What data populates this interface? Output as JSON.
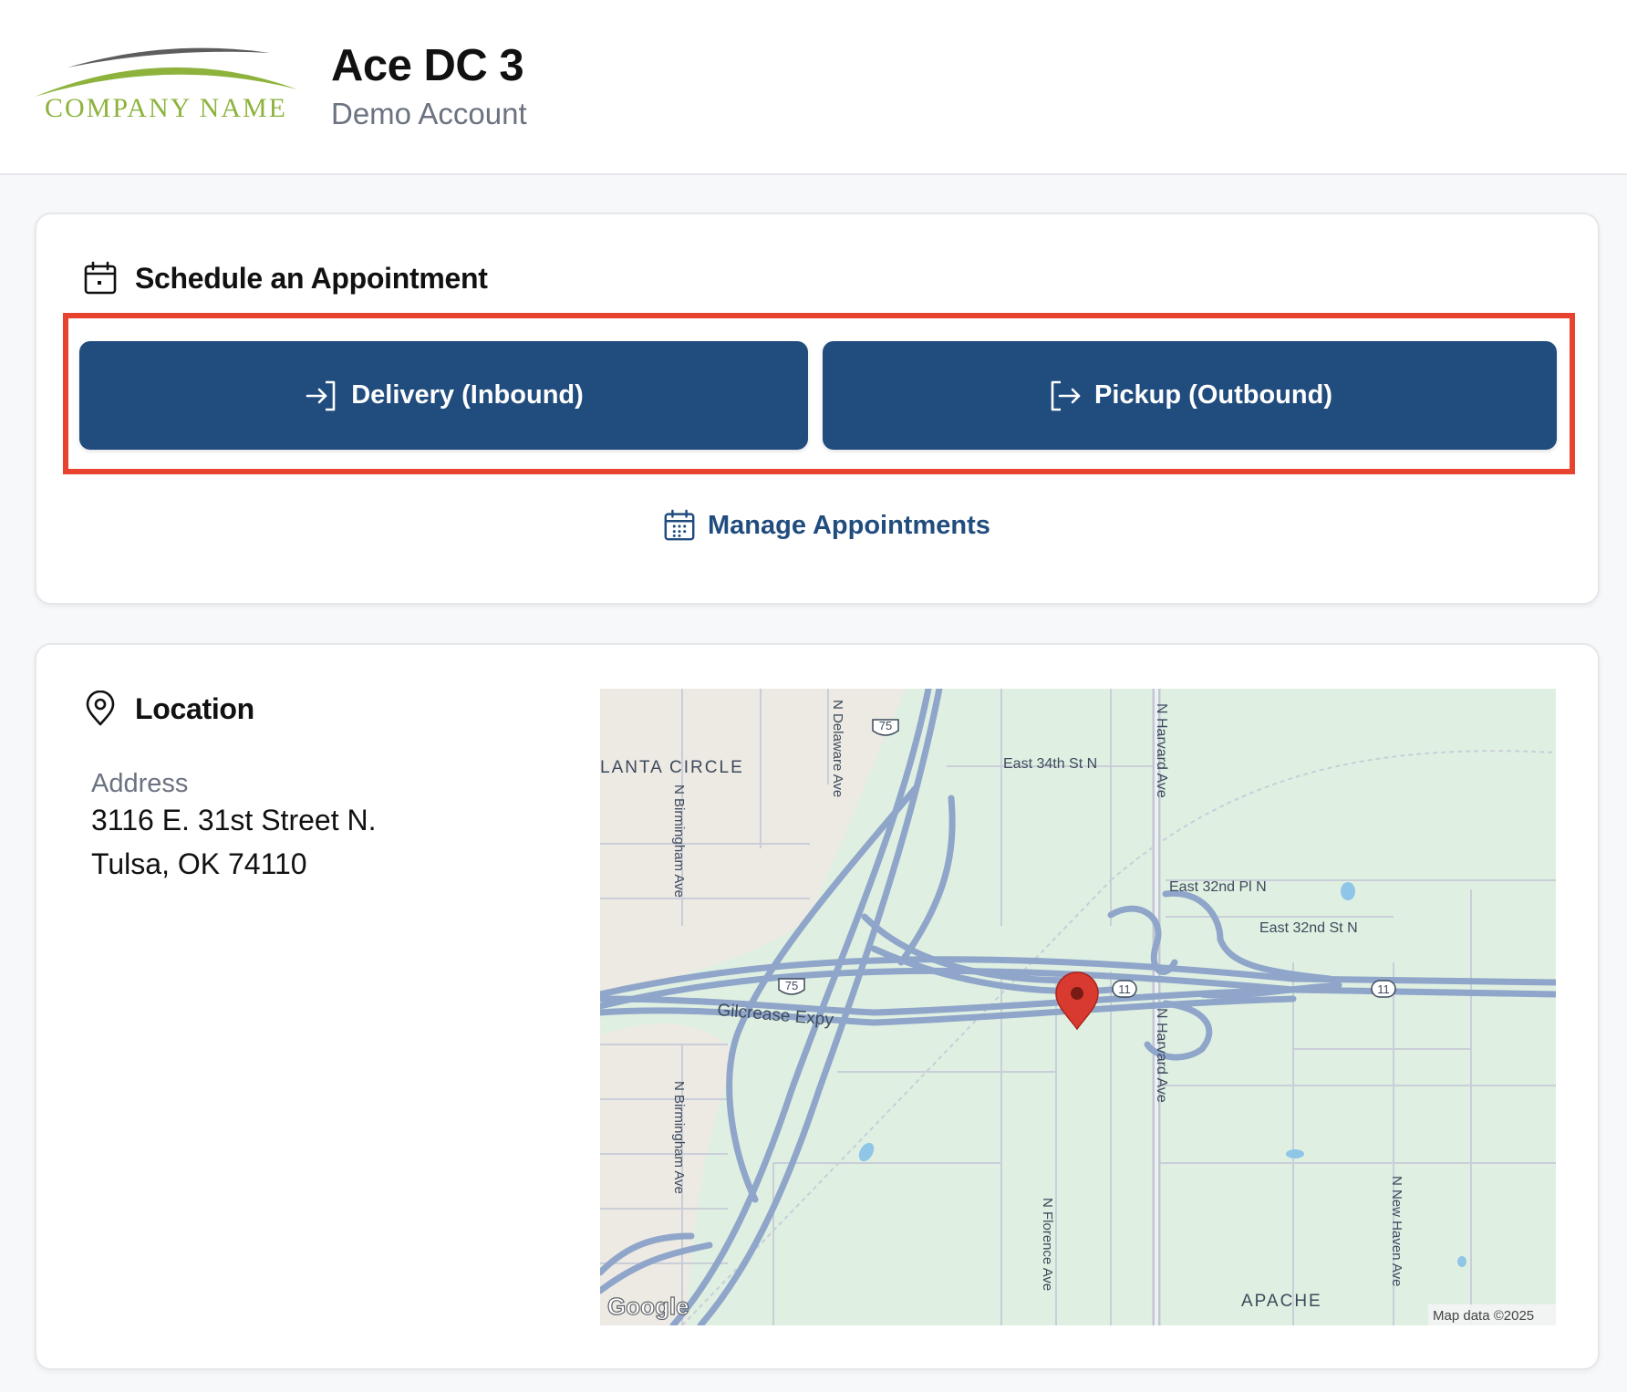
{
  "header": {
    "logo_text": "COMPANY NAME",
    "title": "Ace DC 3",
    "subtitle": "Demo Account"
  },
  "schedule": {
    "title": "Schedule an Appointment",
    "delivery_label": "Delivery (Inbound)",
    "pickup_label": "Pickup (Outbound)",
    "manage_label": "Manage Appointments"
  },
  "location": {
    "title": "Location",
    "address_label": "Address",
    "address_line1": "3116 E. 31st Street N.",
    "address_line2": "Tulsa, OK 74110"
  },
  "map": {
    "labels": {
      "atlanta_circle": "LANTA CIRCLE",
      "delaware": "N Delaware Ave",
      "birmingham_north": "N Birmingham Ave",
      "birmingham_south": "N Birmingham Ave",
      "east_34th": "East 34th St N",
      "harvard_north": "N Harvard Ave",
      "harvard_south": "N Harvard Ave",
      "east_32nd_pl": "East 32nd Pl N",
      "east_32nd_st": "East 32nd St N",
      "gilcrease": "Gilcrease Expy",
      "florence": "N Florence Ave",
      "new_haven": "N New Haven Ave",
      "apache": "APACHE",
      "shield_75a": "75",
      "shield_75b": "75",
      "shield_11a": "11",
      "shield_11b": "11",
      "google": "Google",
      "map_data": "Map data ©2025"
    }
  },
  "colors": {
    "primary": "#214c7e",
    "highlight": "#e8432e",
    "logo_green": "#8db33c",
    "map_green": "#dff0e2",
    "map_tan": "#ede9e3",
    "highway": "#8fa5c9",
    "marker": "#d93a2f"
  },
  "icons": {
    "schedule": "calendar-icon",
    "delivery": "login-arrow-icon",
    "pickup": "logout-arrow-icon",
    "manage": "calendar-grid-icon",
    "location": "map-pin-icon",
    "marker": "map-marker-icon"
  }
}
